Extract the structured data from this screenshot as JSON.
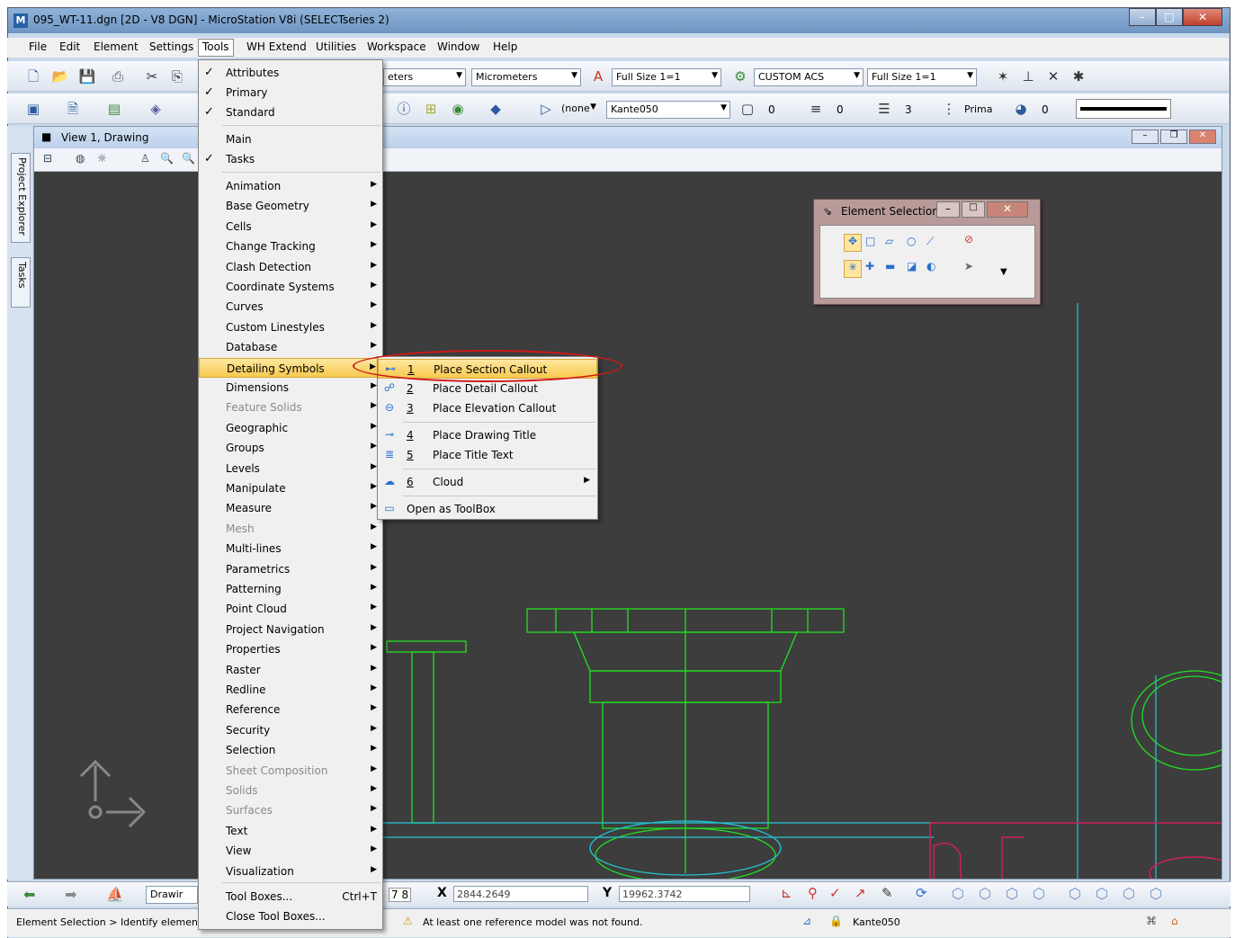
{
  "window": {
    "title": "095_WT-11.dgn [2D - V8 DGN] - MicroStation V8i (SELECTseries 2)"
  },
  "menubar": [
    "File",
    "Edit",
    "Element",
    "Settings",
    "Tools",
    "WH Extend",
    "Utilities",
    "Workspace",
    "Window",
    "Help"
  ],
  "toolbar1": {
    "units_left": "eters",
    "units": "Micrometers",
    "scale1": "Full Size 1=1",
    "acs": "CUSTOM ACS",
    "scale2": "Full Size 1=1"
  },
  "toolbar2": {
    "level_none": "(none",
    "linestyle": "Kante050",
    "color_val": "0",
    "weight_val": "0",
    "style_val": "3",
    "priority": "Prima",
    "trans_val": "0"
  },
  "view": {
    "title": "View 1, Drawing"
  },
  "left_tabs": [
    "Project Explorer",
    "Tasks"
  ],
  "tools_menu": {
    "checked": [
      "Attributes",
      "Primary",
      "Standard"
    ],
    "main": [
      "Main",
      "Tasks"
    ],
    "items": [
      "Animation",
      "Base Geometry",
      "Cells",
      "Change Tracking",
      "Clash Detection",
      "Coordinate Systems",
      "Curves",
      "Custom Linestyles",
      "Database",
      "Detailing Symbols",
      "Dimensions",
      "Feature Solids",
      "Geographic",
      "Groups",
      "Levels",
      "Manipulate",
      "Measure",
      "Mesh",
      "Multi-lines",
      "Parametrics",
      "Patterning",
      "Point Cloud",
      "Project Navigation",
      "Properties",
      "Raster",
      "Redline",
      "Reference",
      "Security",
      "Selection",
      "Sheet Composition",
      "Solids",
      "Surfaces",
      "Text",
      "View",
      "Visualization"
    ],
    "bottom": [
      {
        "label": "Tool Boxes...",
        "shortcut": "Ctrl+T"
      },
      {
        "label": "Close Tool Boxes...",
        "shortcut": ""
      }
    ]
  },
  "submenu": [
    {
      "num": "1",
      "label": "Place Section Callout"
    },
    {
      "num": "2",
      "label": "Place Detail Callout"
    },
    {
      "num": "3",
      "label": "Place Elevation Callout"
    },
    {
      "num": "4",
      "label": "Place Drawing Title"
    },
    {
      "num": "5",
      "label": "Place Title Text"
    },
    {
      "num": "6",
      "label": "Cloud"
    },
    {
      "num": "",
      "label": "Open as ToolBox"
    }
  ],
  "element_selection": {
    "title": "Element Selection"
  },
  "bottombar": {
    "view_label": "Drawir",
    "x_label": "X",
    "x_value": "2844.2649",
    "y_label": "Y",
    "y_value": "19962.3742",
    "views": "7 8"
  },
  "status": {
    "prompt": "Element Selection > Identify element to a",
    "message": "At least one reference model was not found.",
    "linestyle": "Kante050"
  },
  "colors": {
    "accent_highlight": "#f8c94e",
    "annotation_oval": "#d01818",
    "canvas": "#3d3d3d",
    "drawing_green": "#22e022",
    "drawing_cyan": "#22c8d8",
    "drawing_magenta": "#d0205a"
  }
}
